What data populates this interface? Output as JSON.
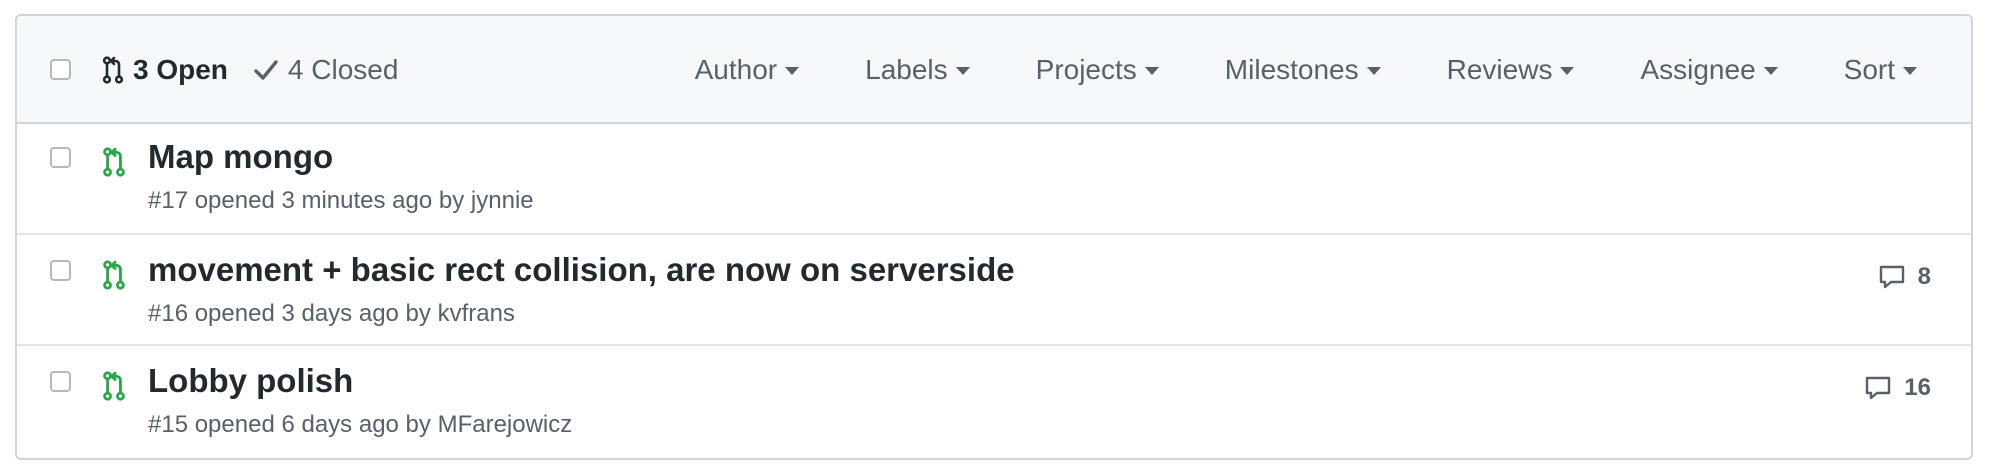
{
  "header": {
    "open_count": "3 Open",
    "closed_count": "4 Closed",
    "filters": [
      {
        "label": "Author"
      },
      {
        "label": "Labels"
      },
      {
        "label": "Projects"
      },
      {
        "label": "Milestones"
      },
      {
        "label": "Reviews"
      },
      {
        "label": "Assignee"
      },
      {
        "label": "Sort"
      }
    ]
  },
  "pull_requests": [
    {
      "title": "Map mongo",
      "meta": "#17 opened 3 minutes ago by jynnie",
      "comments": ""
    },
    {
      "title": "movement + basic rect collision, are now on serverside",
      "meta": "#16 opened 3 days ago by kvfrans",
      "comments": "8"
    },
    {
      "title": "Lobby polish",
      "meta": "#15 opened 6 days ago by MFarejowicz",
      "comments": "16"
    }
  ],
  "icons": {
    "open_pr": "git-pull-request-icon",
    "closed": "check-icon",
    "comment": "comment-icon"
  },
  "colors": {
    "open_pr_icon": "#28a745",
    "header_bg": "#f6f8fa",
    "border": "#d1d5da",
    "muted_text": "#586069",
    "title_text": "#24292e"
  }
}
